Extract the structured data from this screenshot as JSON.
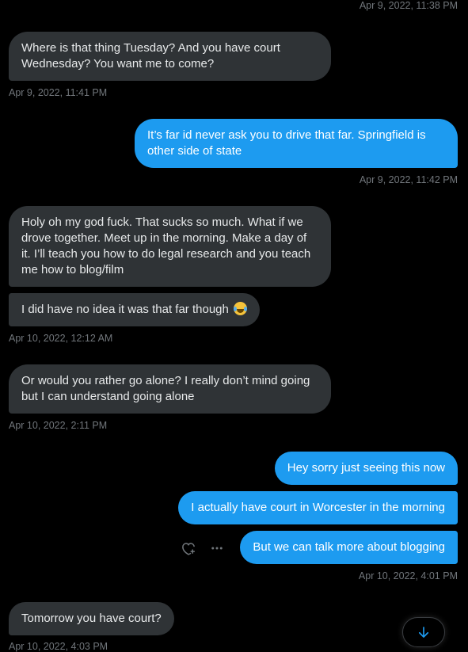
{
  "messages": [
    {
      "dir": "ts-right",
      "text": "Apr 9, 2022, 11:38 PM"
    },
    {
      "dir": "in",
      "text": "Where is that thing Tuesday? And you have court Wednesday? You want me to come?"
    },
    {
      "dir": "ts-left",
      "text": "Apr 9, 2022, 11:41 PM"
    },
    {
      "dir": "out",
      "text": "It’s far id never ask you to drive that far. Springfield is other side of state"
    },
    {
      "dir": "ts-right",
      "text": "Apr 9, 2022, 11:42 PM"
    },
    {
      "dir": "in",
      "text": "Holy oh my god fuck. That sucks so much. What if we drove together. Meet up in the morning. Make a day of it. I’ll teach you how to do legal research and you teach me how to blog/film"
    },
    {
      "dir": "in",
      "text": "I did have no idea it was that far though",
      "emoji": "face-with-tears-of-joy"
    },
    {
      "dir": "ts-left",
      "text": "Apr 10, 2022, 12:12 AM"
    },
    {
      "dir": "in",
      "text": "Or would you rather go alone? I really don’t mind going but I can understand going alone"
    },
    {
      "dir": "ts-left",
      "text": "Apr 10, 2022, 2:11 PM"
    },
    {
      "dir": "out",
      "text": "Hey sorry just seeing this now"
    },
    {
      "dir": "out",
      "text": "I actually have court in Worcester in the morning"
    },
    {
      "dir": "out",
      "text": "But we can talk more about blogging"
    },
    {
      "dir": "ts-right",
      "text": "Apr 10, 2022, 4:01 PM"
    },
    {
      "dir": "in",
      "text": "Tomorrow you have court?"
    },
    {
      "dir": "ts-left",
      "text": "Apr 10, 2022, 4:03 PM"
    }
  ],
  "actions": {
    "react_icon": "heart-plus-icon",
    "more_icon": "more-horizontal-icon"
  },
  "scroll_button": {
    "icon": "arrow-down-icon"
  },
  "colors": {
    "background": "#000000",
    "incoming": "#2f3336",
    "outgoing": "#1d9bf0",
    "timestamp": "#71767b",
    "accent": "#1d9bf0"
  }
}
